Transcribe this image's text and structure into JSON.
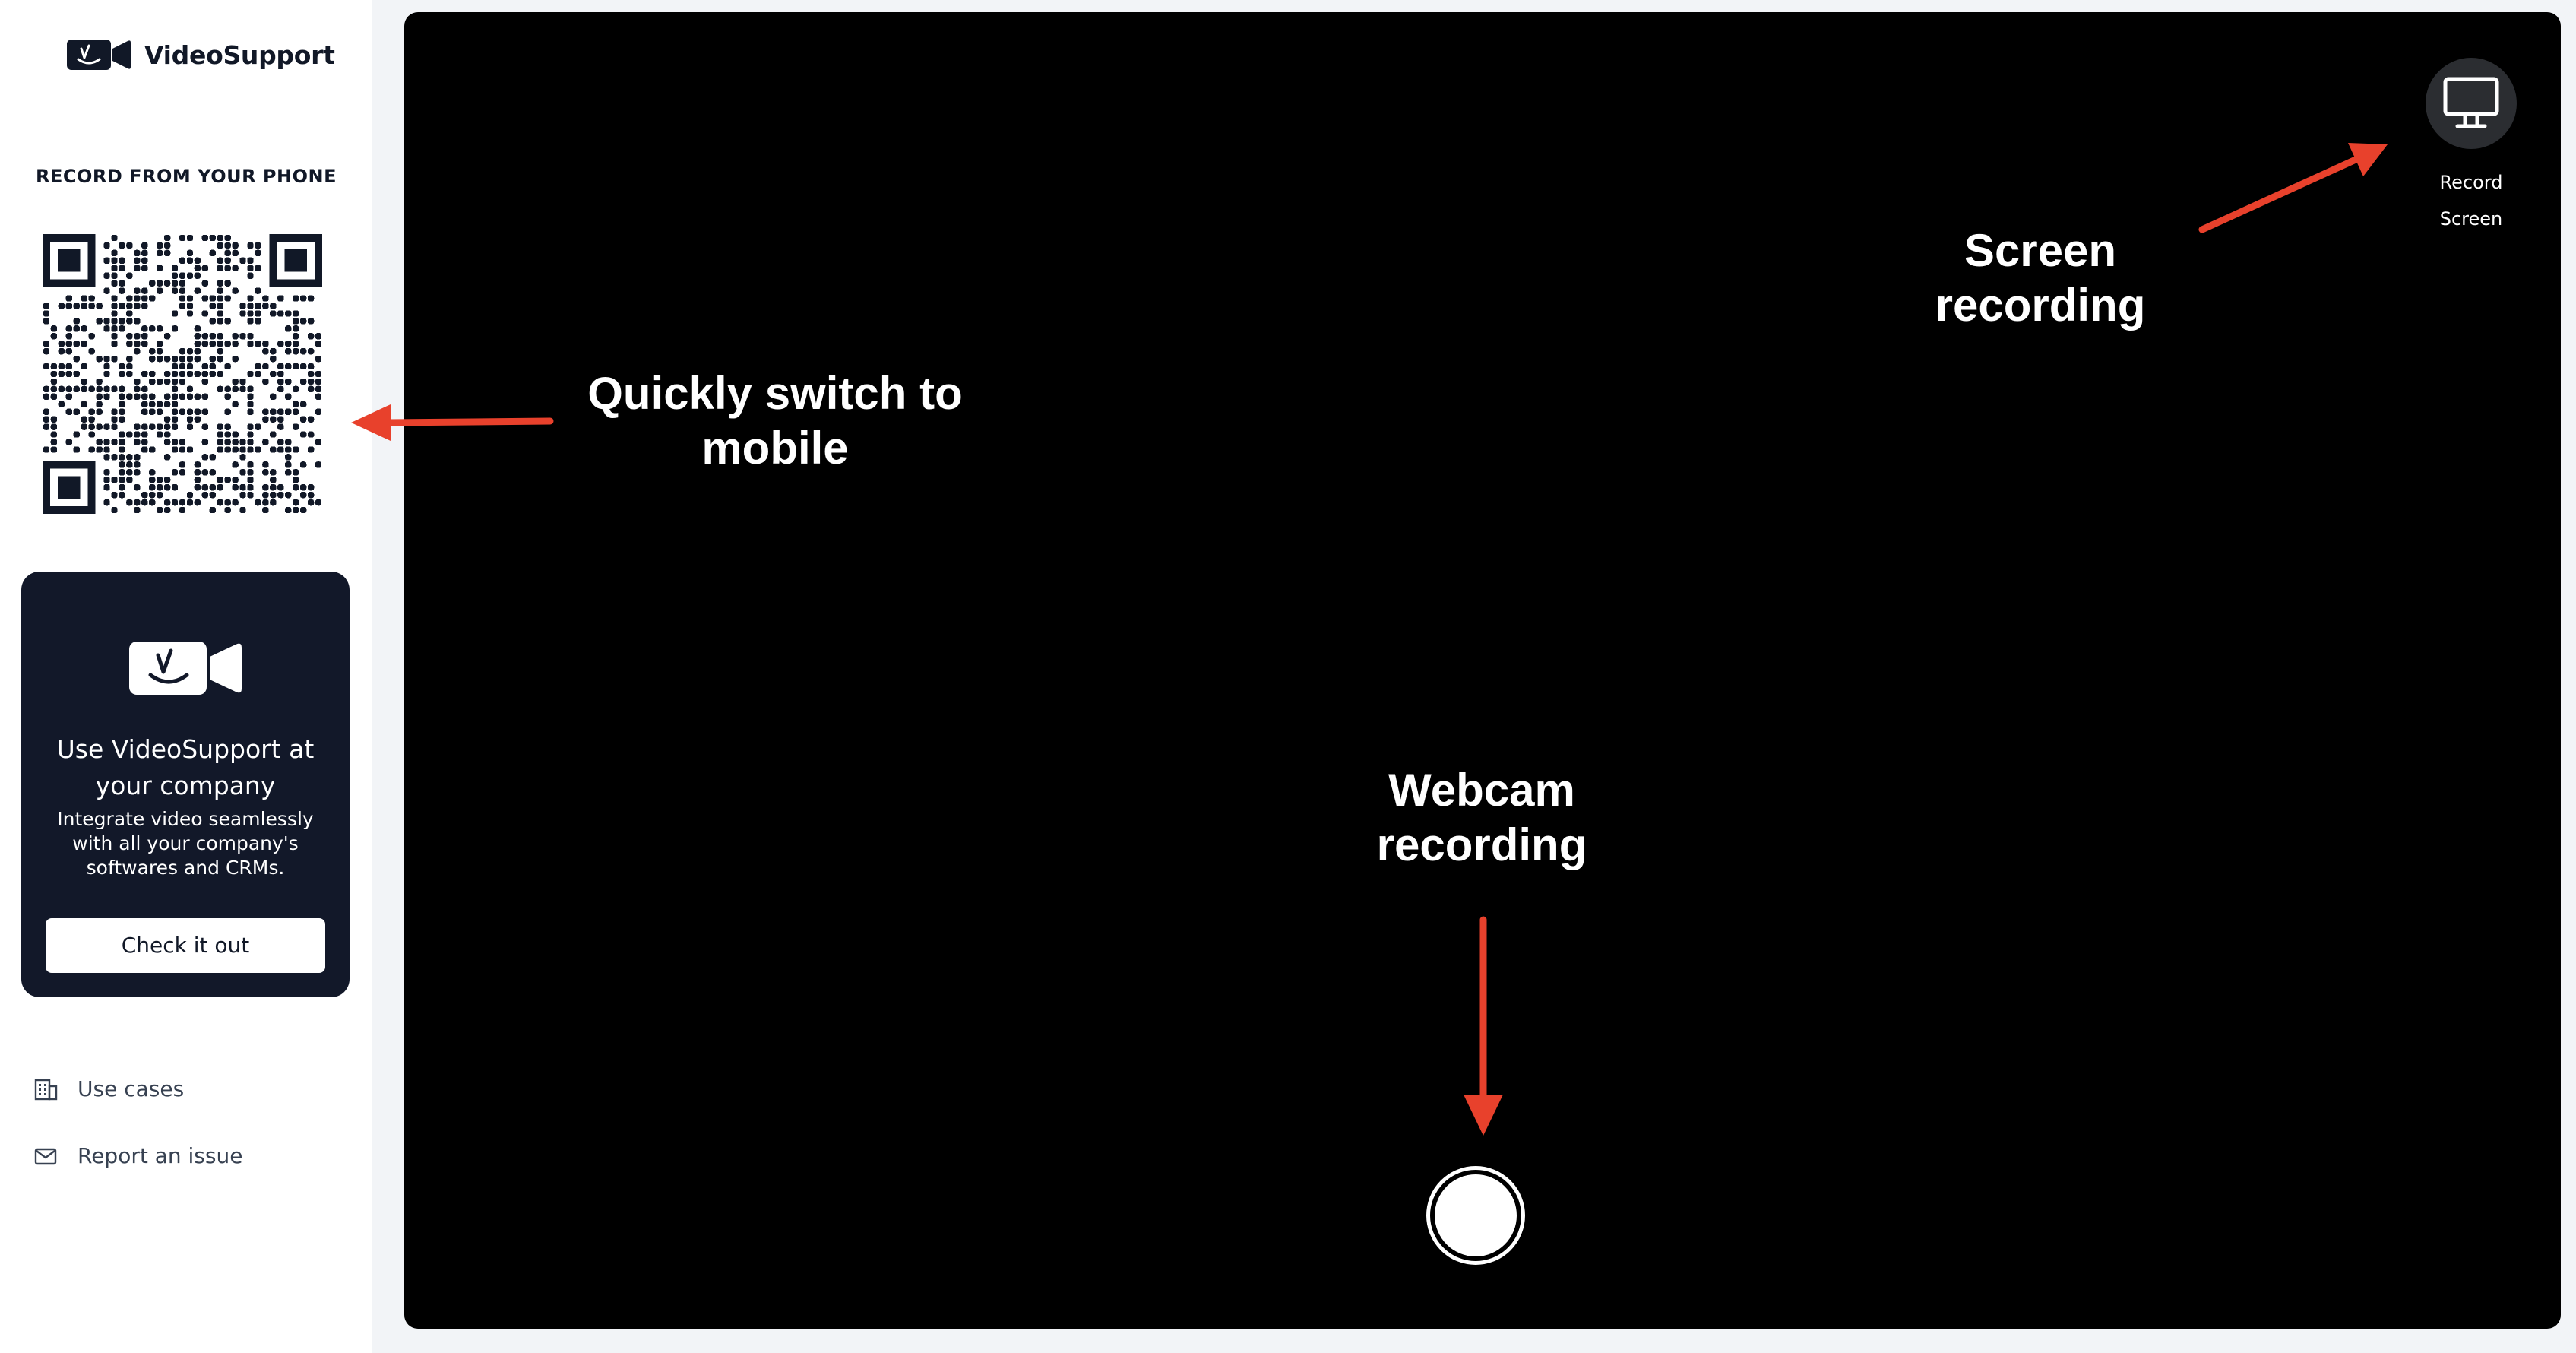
{
  "brand": {
    "name": "VideoSupport",
    "icon": "video-camera-logo-icon"
  },
  "sidebar": {
    "phone_heading": "RECORD FROM YOUR PHONE",
    "promo": {
      "title": "Use VideoSupport at your company",
      "description": "Integrate video seamlessly with all your company's softwares and CRMs.",
      "button_label": "Check it out"
    },
    "nav": {
      "use_cases": {
        "label": "Use cases",
        "icon": "building-icon"
      },
      "report_issue": {
        "label": "Report an issue",
        "icon": "mail-icon"
      }
    }
  },
  "stage": {
    "record_screen_label": "Record Screen",
    "record_screen_icon": "monitor-icon",
    "record_button_icon": "record-circle-icon"
  },
  "annotations": {
    "mobile": "Quickly switch to mobile",
    "screen": "Screen recording",
    "webcam": "Webcam recording"
  },
  "colors": {
    "sidebar_bg": "#ffffff",
    "promo_bg": "#121829",
    "stage_bg": "#000000",
    "annotation_arrow": "#e8412c",
    "record_screen_bg": "#2b2d31"
  }
}
